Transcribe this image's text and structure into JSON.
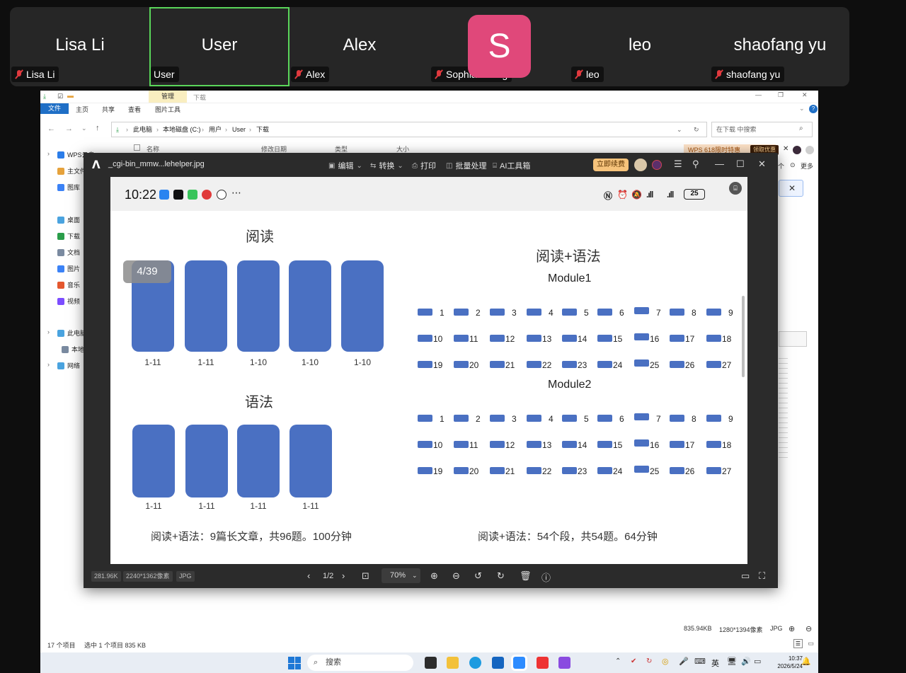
{
  "zoom": {
    "participants": [
      {
        "big": "Lisa Li",
        "label": "Lisa Li",
        "muted": true
      },
      {
        "big": "User",
        "label": "User",
        "muted": false,
        "active": true
      },
      {
        "big": "Alex",
        "label": "Alex",
        "muted": true
      },
      {
        "big": "",
        "label": "Sophia Zhang",
        "muted": true,
        "avatar": "S"
      },
      {
        "big": "leo",
        "label": "leo",
        "muted": true
      },
      {
        "big": "shaofang yu",
        "label": "shaofang yu",
        "muted": true
      }
    ]
  },
  "explorer": {
    "ribbon_manage": "管理",
    "ribbon_download": "下载",
    "tabs": [
      "文件",
      "主页",
      "共享",
      "查看",
      "图片工具"
    ],
    "breadcrumb": [
      "此电脑",
      "本地磁盘 (C:)",
      "用户",
      "User",
      "下载"
    ],
    "search_placeholder": "在下载 中搜索",
    "columns": [
      "名称",
      "修改日期",
      "类型",
      "大小"
    ],
    "nav": [
      {
        "label": "WPS云盘",
        "color": "#2b7de9"
      },
      {
        "label": "主文件夹",
        "color": "#e6a23c"
      },
      {
        "label": "图库",
        "color": "#3b82f6"
      },
      {
        "label": "桌面",
        "color": "#4aa3df"
      },
      {
        "label": "下载",
        "color": "#2a9d4a"
      },
      {
        "label": "文档",
        "color": "#7a8aa0"
      },
      {
        "label": "图片",
        "color": "#3b82f6"
      },
      {
        "label": "音乐",
        "color": "#e4572e"
      },
      {
        "label": "视频",
        "color": "#7c4dff"
      },
      {
        "label": "此电脑",
        "color": "#4aa3df"
      },
      {
        "label": "本地磁盘",
        "color": "#7a8aa0"
      },
      {
        "label": "网络",
        "color": "#4aa3df"
      }
    ],
    "status_items": "17 个项目",
    "status_selected": "选中 1 个项目  835 KB",
    "wps_banner": "WPS 618限时特惠",
    "wps_claim": "领取优惠",
    "more": "更多",
    "right_meta": [
      "835.94KB",
      "1280*1394像素",
      "JPG"
    ]
  },
  "viewer": {
    "filename": "_cgi-bin_mmw...lehelper.jpg",
    "toolbar": [
      "编辑",
      "转换",
      "打印",
      "批量处理",
      "AI工具箱"
    ],
    "renew": "立即续费",
    "footer": {
      "size": "281.96K",
      "dims": "2240*1362像素",
      "fmt": "JPG",
      "page": "1/2",
      "zoom": "70%"
    }
  },
  "slide": {
    "time": "10:22",
    "battery": "25",
    "page_indicator": "4/39",
    "left_title_1": "阅读",
    "left_title_2": "语法",
    "reading_boxes": [
      "1-11",
      "1-11",
      "1-10",
      "1-10",
      "1-10"
    ],
    "grammar_boxes": [
      "1-11",
      "1-11",
      "1-11",
      "1-11"
    ],
    "right_title": "阅读+语法",
    "module1": "Module1",
    "module2": "Module2",
    "grid_numbers": [
      "1",
      "2",
      "3",
      "4",
      "5",
      "6",
      "7",
      "8",
      "9",
      "10",
      "11",
      "12",
      "13",
      "14",
      "15",
      "16",
      "17",
      "18",
      "19",
      "20",
      "21",
      "22",
      "23",
      "24",
      "25",
      "26",
      "27"
    ],
    "note_left": "阅读+语法：9篇长文章，共96题。100分钟",
    "note_right": "阅读+语法：54个段，共54题。64分钟",
    "colors": {
      "block": "#4a70c2"
    }
  },
  "taskbar": {
    "search": "搜索",
    "ime": "英",
    "time": "10:37",
    "date": "2026/5/24"
  }
}
